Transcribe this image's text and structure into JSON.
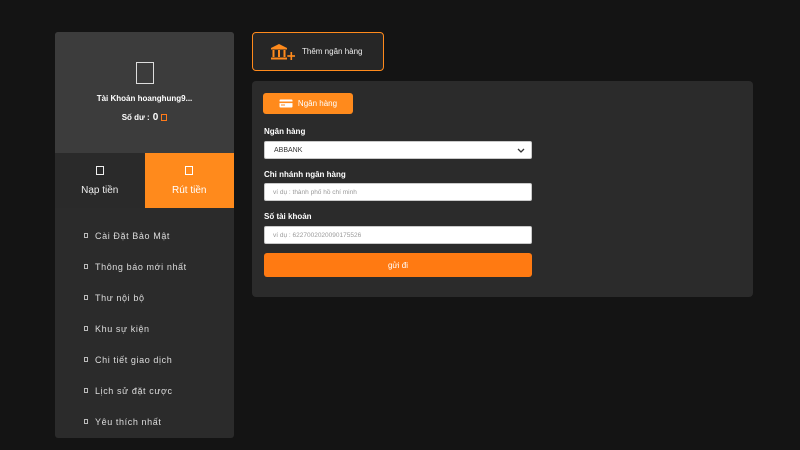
{
  "account": {
    "name": "Tài Khoản hoanghung9...",
    "balance_label": "Số dư :",
    "balance_value": "0"
  },
  "tabs": [
    {
      "label": "Nạp tiền"
    },
    {
      "label": "Rút tiền"
    }
  ],
  "menu": [
    {
      "label": "Cài Đặt Bảo Mật"
    },
    {
      "label": "Thông báo mới nhất"
    },
    {
      "label": "Thư nội bộ"
    },
    {
      "label": "Khu sự kiện"
    },
    {
      "label": "Chi tiết giao dịch"
    },
    {
      "label": "Lịch sử đặt cược"
    },
    {
      "label": "Yêu thích nhất"
    }
  ],
  "add_bank_label": "Thêm ngân hàng",
  "form": {
    "section_label": "Ngân hàng",
    "bank_label": "Ngân hàng",
    "bank_value": "ABBANK",
    "branch_label": "Chi nhánh ngân hàng",
    "branch_placeholder": "ví dụ : thành phố hồ chí minh",
    "account_label": "Số tài khoản",
    "account_placeholder": "ví dụ : 6227002020090175526",
    "submit_label": "gửi đi"
  },
  "colors": {
    "accent": "#ff8a1c",
    "background": "#141414",
    "panel": "#2b2b2b"
  }
}
